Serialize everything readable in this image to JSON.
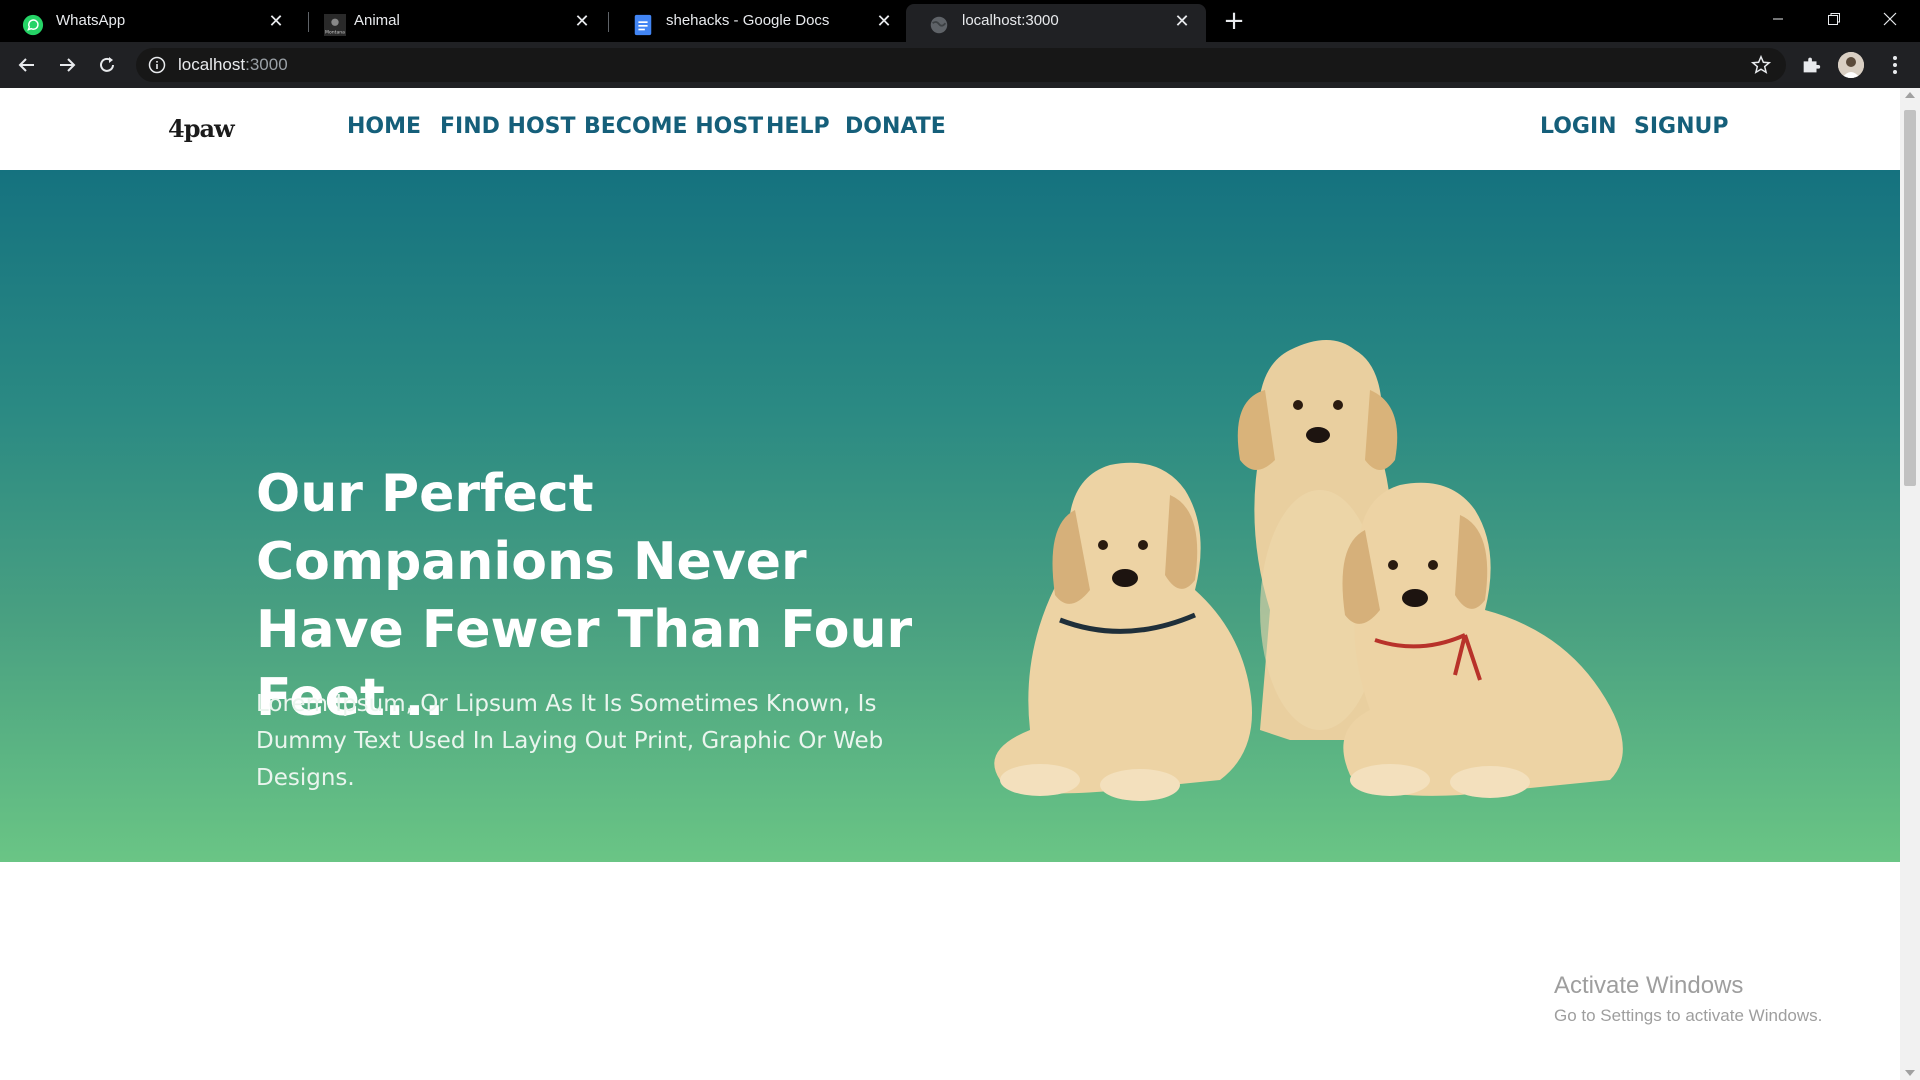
{
  "browser": {
    "tabs": [
      {
        "title": "WhatsApp",
        "icon": "whatsapp-icon",
        "active": false
      },
      {
        "title": "Animal",
        "icon": "animal-site-icon",
        "active": false
      },
      {
        "title": "shehacks - Google Docs",
        "icon": "google-docs-icon",
        "active": false
      },
      {
        "title": "localhost:3000",
        "icon": "globe-icon",
        "active": true
      }
    ],
    "favicon_caption": "Montana",
    "url_host": "localhost",
    "url_port": ":3000",
    "watermark_title": "Activate Windows",
    "watermark_sub": "Go to Settings to activate Windows."
  },
  "site": {
    "logo": "4paw",
    "nav": {
      "home": "HOME",
      "find_host": "FIND HOST",
      "become_host": "BECOME HOST",
      "help": "HELP",
      "donate": "DONATE",
      "login": "LOGIN",
      "signup": "SIGNUP"
    },
    "hero": {
      "headline": "Our Perfect Companions Never Have Fewer Than Four Feet...",
      "subtext": "Lorem Ipsum, Or Lipsum As It Is Sometimes Known, Is Dummy Text Used In Laying Out Print, Graphic Or Web Designs."
    }
  },
  "colors": {
    "nav_link": "#155f7a",
    "hero_top": "#15727f",
    "hero_bottom": "#6ac585",
    "tab_strip": "#000000",
    "toolbar": "#202124"
  }
}
